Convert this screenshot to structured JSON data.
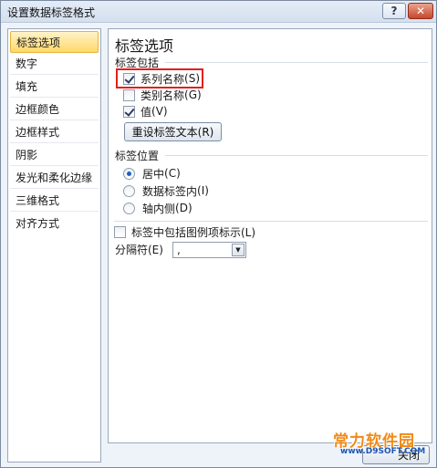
{
  "window": {
    "title": "设置数据标签格式"
  },
  "titlebar": {
    "help": "?",
    "close": "✕"
  },
  "sidebar": {
    "items": [
      {
        "label": "标签选项",
        "selected": true
      },
      {
        "label": "数字"
      },
      {
        "label": "填充"
      },
      {
        "label": "边框颜色"
      },
      {
        "label": "边框样式"
      },
      {
        "label": "阴影"
      },
      {
        "label": "发光和柔化边缘"
      },
      {
        "label": "三维格式"
      },
      {
        "label": "对齐方式"
      }
    ]
  },
  "panel": {
    "title": "标签选项",
    "contains": {
      "label": "标签包括",
      "series_name": {
        "label": "系列名称",
        "hotkey": "(S)",
        "checked": true
      },
      "category_name": {
        "label": "类别名称",
        "hotkey": "(G)",
        "checked": false
      },
      "value": {
        "label": "值",
        "hotkey": "(V)",
        "checked": true
      },
      "reset_button": "重设标签文本(R)"
    },
    "position": {
      "label": "标签位置",
      "options": [
        {
          "label": "居中",
          "hotkey": "(C)",
          "checked": true
        },
        {
          "label": "数据标签内",
          "hotkey": "(I)",
          "checked": false
        },
        {
          "label": "轴内侧",
          "hotkey": "(D)",
          "checked": false
        }
      ]
    },
    "legend_key": {
      "label": "标签中包括图例项标示(L)",
      "checked": false
    },
    "separator": {
      "label": "分隔符(E)",
      "value": ","
    }
  },
  "footer": {
    "close_button": "关闭"
  },
  "watermark": {
    "main": "常力软件园",
    "sub": "www.D9SOFT.COM"
  },
  "colors": {
    "highlight": "#e0211d",
    "selected_bg": "#ffd86a"
  }
}
